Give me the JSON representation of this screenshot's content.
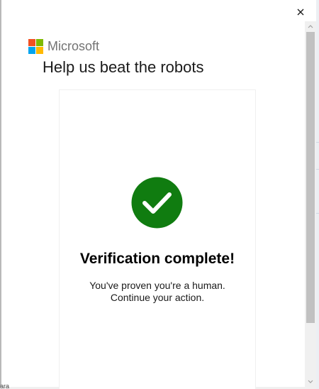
{
  "window": {
    "close_icon": "close-icon"
  },
  "brand": {
    "name": "Microsoft",
    "logo_colors": [
      "#f25022",
      "#7fba00",
      "#00a4ef",
      "#ffb900"
    ]
  },
  "page": {
    "title": "Help us beat the robots"
  },
  "verification": {
    "status_icon": "checkmark-circle-icon",
    "status_color": "#107c10",
    "heading": "Verification complete!",
    "message_line1": "You've proven you're a human.",
    "message_line2": "Continue your action."
  },
  "background_peek": {
    "text": "ara"
  }
}
